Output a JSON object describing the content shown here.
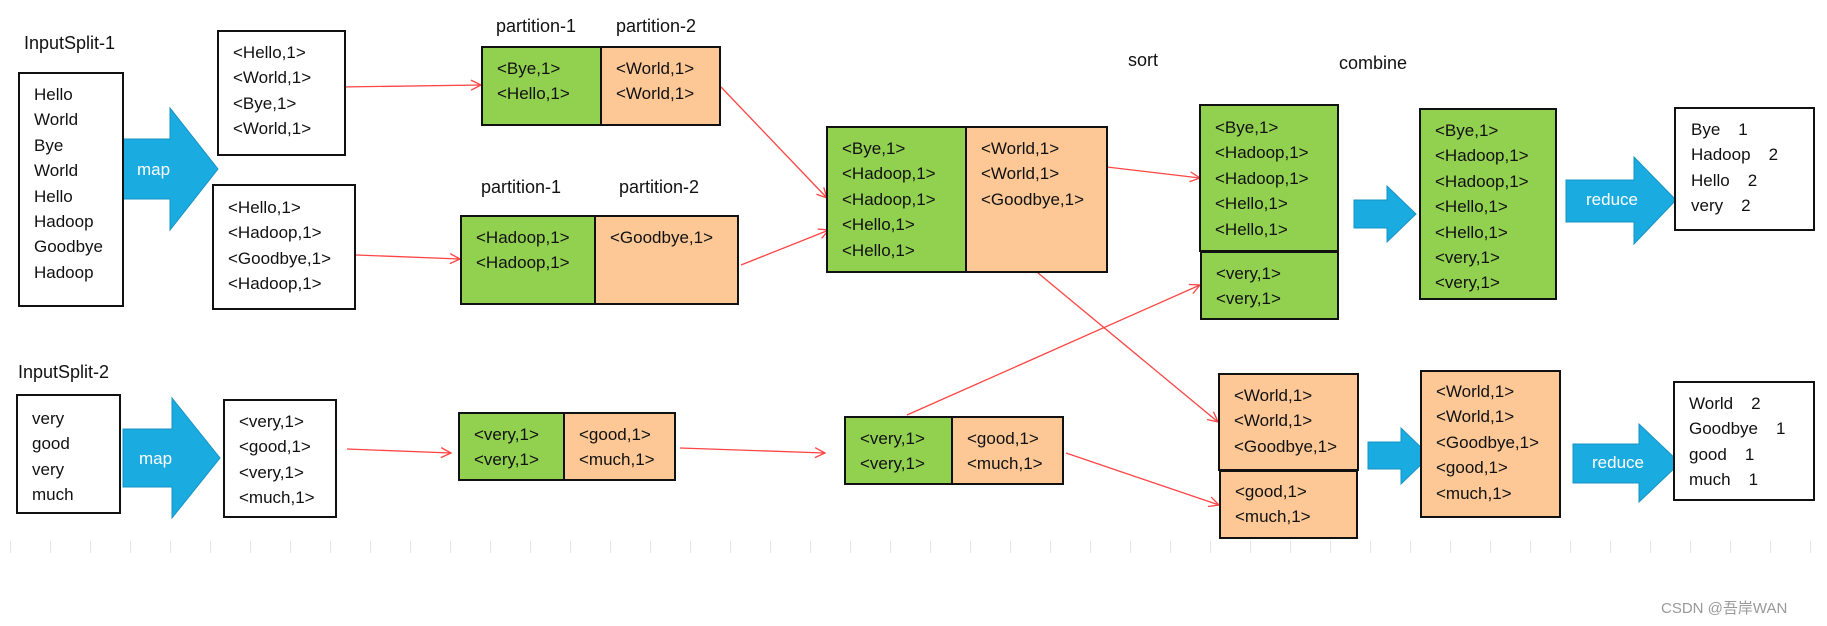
{
  "labels": {
    "inputsplit1": "InputSplit-1",
    "inputsplit2": "InputSplit-2",
    "partition1": "partition-1",
    "partition2": "partition-2",
    "sort": "sort",
    "combine": "combine",
    "map": "map",
    "reduce": "reduce"
  },
  "input1": [
    "Hello",
    "World",
    "Bye",
    "World",
    "Hello",
    "Hadoop",
    "Goodbye",
    "Hadoop"
  ],
  "input2": [
    "very",
    "good",
    "very",
    "much"
  ],
  "map_out_a": [
    "<Hello,1>",
    "<World,1>",
    "<Bye,1>",
    "<World,1>"
  ],
  "map_out_b": [
    "<Hello,1>",
    "<Hadoop,1>",
    "<Goodbye,1>",
    "<Hadoop,1>"
  ],
  "map_out_c": [
    "<very,1>",
    "<good,1>",
    "<very,1>",
    "<much,1>"
  ],
  "part_a": {
    "p1": [
      "<Bye,1>",
      "<Hello,1>"
    ],
    "p2": [
      "<World,1>",
      "<World,1>"
    ]
  },
  "part_b": {
    "p1": [
      "<Hadoop,1>",
      "<Hadoop,1>"
    ],
    "p2": [
      "<Goodbye,1>"
    ]
  },
  "part_c": {
    "p1": [
      "<very,1>",
      "<very,1>"
    ],
    "p2": [
      "<good,1>",
      "<much,1>"
    ]
  },
  "merged_1": {
    "p1": [
      "<Bye,1>",
      "<Hadoop,1>",
      "<Hadoop,1>",
      "<Hello,1>",
      "<Hello,1>"
    ],
    "p2": [
      "<World,1>",
      "<World,1>",
      "<Goodbye,1>"
    ]
  },
  "merged_2": {
    "p1": [
      "<very,1>",
      "<very,1>"
    ],
    "p2": [
      "<good,1>",
      "<much,1>"
    ]
  },
  "sort_p1_a": [
    "<Bye,1>",
    "<Hadoop,1>",
    "<Hadoop,1>",
    "<Hello,1>",
    "<Hello,1>"
  ],
  "sort_p1_b": [
    "<very,1>",
    "<very,1>"
  ],
  "sort_p2_a": [
    "<World,1>",
    "<World,1>",
    "<Goodbye,1>"
  ],
  "sort_p2_b": [
    "<good,1>",
    "<much,1>"
  ],
  "combine_p1": [
    "<Bye,1>",
    "<Hadoop,1>",
    "<Hadoop,1>",
    "<Hello,1>",
    "<Hello,1>",
    "<very,1>",
    "<very,1>"
  ],
  "combine_p2": [
    "<World,1>",
    "<World,1>",
    "<Goodbye,1>",
    "<good,1>",
    "<much,1>"
  ],
  "result_1": [
    {
      "word": "Bye",
      "count": "1"
    },
    {
      "word": "Hadoop",
      "count": "2"
    },
    {
      "word": "Hello",
      "count": "2"
    },
    {
      "word": "very",
      "count": "2"
    }
  ],
  "result_2": [
    {
      "word": "World",
      "count": "2"
    },
    {
      "word": "Goodbye",
      "count": "1"
    },
    {
      "word": "good",
      "count": "1"
    },
    {
      "word": "much",
      "count": "1"
    }
  ],
  "watermark": "CSDN @吾岸WAN",
  "colors": {
    "partition1": "#92d050",
    "partition2": "#fdc896",
    "arrow_blue": "#1aabe0",
    "flow_red": "#ff4444"
  }
}
